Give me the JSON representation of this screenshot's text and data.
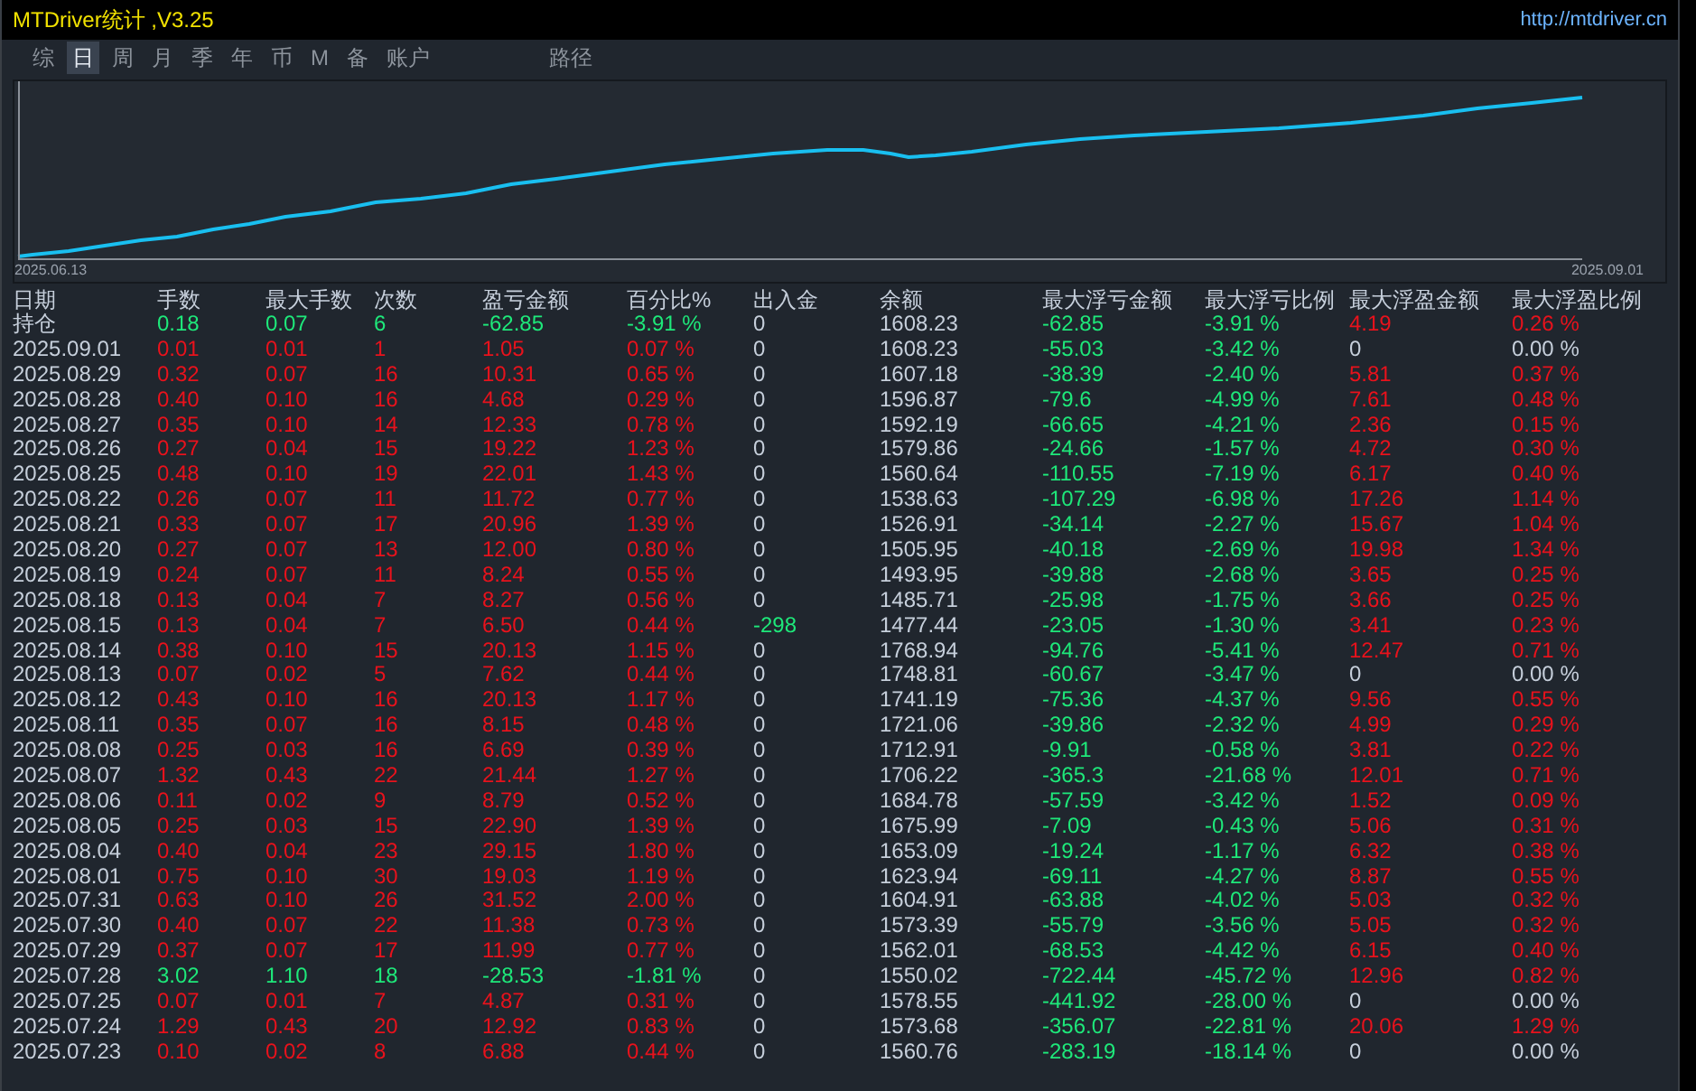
{
  "window": {
    "title": "MTDriver统计 ,V3.25",
    "link": "http://mtdriver.cn"
  },
  "tabs": [
    {
      "label": "综",
      "selected": false
    },
    {
      "label": "日",
      "selected": true
    },
    {
      "label": "周",
      "selected": false
    },
    {
      "label": "月",
      "selected": false
    },
    {
      "label": "季",
      "selected": false
    },
    {
      "label": "年",
      "selected": false
    },
    {
      "label": "币",
      "selected": false
    },
    {
      "label": "M",
      "selected": false
    },
    {
      "label": "备",
      "selected": false
    },
    {
      "label": "账户",
      "selected": false
    },
    {
      "label": "路径",
      "selected": false
    }
  ],
  "chart": {
    "start_label": "2025.06.13",
    "end_label": "2025.09.01"
  },
  "table": {
    "columns": [
      "日期",
      "手数",
      "最大手数",
      "次数",
      "盈亏金额",
      "百分比%",
      "出入金",
      "余额",
      "最大浮亏金额",
      "最大浮亏比例",
      "最大浮盈金额",
      "最大浮盈比例"
    ],
    "rows": [
      {
        "kind": "position",
        "withdrawal": false,
        "float_gain": true,
        "cells": [
          "持仓",
          "0.18",
          "0.07",
          "6",
          "-62.85",
          "-3.91 %",
          "0",
          "1608.23",
          "-62.85",
          "-3.91 %",
          "4.19",
          "0.26 %"
        ]
      },
      {
        "kind": "gain",
        "withdrawal": false,
        "float_gain": false,
        "cells": [
          "2025.09.01",
          "0.01",
          "0.01",
          "1",
          "1.05",
          "0.07 %",
          "0",
          "1608.23",
          "-55.03",
          "-3.42 %",
          "0",
          "0.00 %"
        ]
      },
      {
        "kind": "gain",
        "withdrawal": false,
        "float_gain": true,
        "cells": [
          "2025.08.29",
          "0.32",
          "0.07",
          "16",
          "10.31",
          "0.65 %",
          "0",
          "1607.18",
          "-38.39",
          "-2.40 %",
          "5.81",
          "0.37 %"
        ]
      },
      {
        "kind": "gain",
        "withdrawal": false,
        "float_gain": true,
        "cells": [
          "2025.08.28",
          "0.40",
          "0.10",
          "16",
          "4.68",
          "0.29 %",
          "0",
          "1596.87",
          "-79.6",
          "-4.99 %",
          "7.61",
          "0.48 %"
        ]
      },
      {
        "kind": "gain",
        "withdrawal": false,
        "float_gain": true,
        "cells": [
          "2025.08.27",
          "0.35",
          "0.10",
          "14",
          "12.33",
          "0.78 %",
          "0",
          "1592.19",
          "-66.65",
          "-4.21 %",
          "2.36",
          "0.15 %"
        ]
      },
      {
        "kind": "gain",
        "withdrawal": false,
        "float_gain": true,
        "cells": [
          "2025.08.26",
          "0.27",
          "0.04",
          "15",
          "19.22",
          "1.23 %",
          "0",
          "1579.86",
          "-24.66",
          "-1.57 %",
          "4.72",
          "0.30 %"
        ]
      },
      {
        "kind": "gain",
        "withdrawal": false,
        "float_gain": true,
        "cells": [
          "2025.08.25",
          "0.48",
          "0.10",
          "19",
          "22.01",
          "1.43 %",
          "0",
          "1560.64",
          "-110.55",
          "-7.19 %",
          "6.17",
          "0.40 %"
        ]
      },
      {
        "kind": "gain",
        "withdrawal": false,
        "float_gain": true,
        "cells": [
          "2025.08.22",
          "0.26",
          "0.07",
          "11",
          "11.72",
          "0.77 %",
          "0",
          "1538.63",
          "-107.29",
          "-6.98 %",
          "17.26",
          "1.14 %"
        ]
      },
      {
        "kind": "gain",
        "withdrawal": false,
        "float_gain": true,
        "cells": [
          "2025.08.21",
          "0.33",
          "0.07",
          "17",
          "20.96",
          "1.39 %",
          "0",
          "1526.91",
          "-34.14",
          "-2.27 %",
          "15.67",
          "1.04 %"
        ]
      },
      {
        "kind": "gain",
        "withdrawal": false,
        "float_gain": true,
        "cells": [
          "2025.08.20",
          "0.27",
          "0.07",
          "13",
          "12.00",
          "0.80 %",
          "0",
          "1505.95",
          "-40.18",
          "-2.69 %",
          "19.98",
          "1.34 %"
        ]
      },
      {
        "kind": "gain",
        "withdrawal": false,
        "float_gain": true,
        "cells": [
          "2025.08.19",
          "0.24",
          "0.07",
          "11",
          "8.24",
          "0.55 %",
          "0",
          "1493.95",
          "-39.88",
          "-2.68 %",
          "3.65",
          "0.25 %"
        ]
      },
      {
        "kind": "gain",
        "withdrawal": false,
        "float_gain": true,
        "cells": [
          "2025.08.18",
          "0.13",
          "0.04",
          "7",
          "8.27",
          "0.56 %",
          "0",
          "1485.71",
          "-25.98",
          "-1.75 %",
          "3.66",
          "0.25 %"
        ]
      },
      {
        "kind": "gain",
        "withdrawal": true,
        "float_gain": true,
        "cells": [
          "2025.08.15",
          "0.13",
          "0.04",
          "7",
          "6.50",
          "0.44 %",
          "-298",
          "1477.44",
          "-23.05",
          "-1.30 %",
          "3.41",
          "0.23 %"
        ]
      },
      {
        "kind": "gain",
        "withdrawal": false,
        "float_gain": true,
        "cells": [
          "2025.08.14",
          "0.38",
          "0.10",
          "15",
          "20.13",
          "1.15 %",
          "0",
          "1768.94",
          "-94.76",
          "-5.41 %",
          "12.47",
          "0.71 %"
        ]
      },
      {
        "kind": "gain",
        "withdrawal": false,
        "float_gain": false,
        "cells": [
          "2025.08.13",
          "0.07",
          "0.02",
          "5",
          "7.62",
          "0.44 %",
          "0",
          "1748.81",
          "-60.67",
          "-3.47 %",
          "0",
          "0.00 %"
        ]
      },
      {
        "kind": "gain",
        "withdrawal": false,
        "float_gain": true,
        "cells": [
          "2025.08.12",
          "0.43",
          "0.10",
          "16",
          "20.13",
          "1.17 %",
          "0",
          "1741.19",
          "-75.36",
          "-4.37 %",
          "9.56",
          "0.55 %"
        ]
      },
      {
        "kind": "gain",
        "withdrawal": false,
        "float_gain": true,
        "cells": [
          "2025.08.11",
          "0.35",
          "0.07",
          "16",
          "8.15",
          "0.48 %",
          "0",
          "1721.06",
          "-39.86",
          "-2.32 %",
          "4.99",
          "0.29 %"
        ]
      },
      {
        "kind": "gain",
        "withdrawal": false,
        "float_gain": true,
        "cells": [
          "2025.08.08",
          "0.25",
          "0.03",
          "16",
          "6.69",
          "0.39 %",
          "0",
          "1712.91",
          "-9.91",
          "-0.58 %",
          "3.81",
          "0.22 %"
        ]
      },
      {
        "kind": "gain",
        "withdrawal": false,
        "float_gain": true,
        "cells": [
          "2025.08.07",
          "1.32",
          "0.43",
          "22",
          "21.44",
          "1.27 %",
          "0",
          "1706.22",
          "-365.3",
          "-21.68 %",
          "12.01",
          "0.71 %"
        ]
      },
      {
        "kind": "gain",
        "withdrawal": false,
        "float_gain": true,
        "cells": [
          "2025.08.06",
          "0.11",
          "0.02",
          "9",
          "8.79",
          "0.52 %",
          "0",
          "1684.78",
          "-57.59",
          "-3.42 %",
          "1.52",
          "0.09 %"
        ]
      },
      {
        "kind": "gain",
        "withdrawal": false,
        "float_gain": true,
        "cells": [
          "2025.08.05",
          "0.25",
          "0.03",
          "15",
          "22.90",
          "1.39 %",
          "0",
          "1675.99",
          "-7.09",
          "-0.43 %",
          "5.06",
          "0.31 %"
        ]
      },
      {
        "kind": "gain",
        "withdrawal": false,
        "float_gain": true,
        "cells": [
          "2025.08.04",
          "0.40",
          "0.04",
          "23",
          "29.15",
          "1.80 %",
          "0",
          "1653.09",
          "-19.24",
          "-1.17 %",
          "6.32",
          "0.38 %"
        ]
      },
      {
        "kind": "gain",
        "withdrawal": false,
        "float_gain": true,
        "cells": [
          "2025.08.01",
          "0.75",
          "0.10",
          "30",
          "19.03",
          "1.19 %",
          "0",
          "1623.94",
          "-69.11",
          "-4.27 %",
          "8.87",
          "0.55 %"
        ]
      },
      {
        "kind": "gain",
        "withdrawal": false,
        "float_gain": true,
        "cells": [
          "2025.07.31",
          "0.63",
          "0.10",
          "26",
          "31.52",
          "2.00 %",
          "0",
          "1604.91",
          "-63.88",
          "-4.02 %",
          "5.03",
          "0.32 %"
        ]
      },
      {
        "kind": "gain",
        "withdrawal": false,
        "float_gain": true,
        "cells": [
          "2025.07.30",
          "0.40",
          "0.07",
          "22",
          "11.38",
          "0.73 %",
          "0",
          "1573.39",
          "-55.79",
          "-3.56 %",
          "5.05",
          "0.32 %"
        ]
      },
      {
        "kind": "gain",
        "withdrawal": false,
        "float_gain": true,
        "cells": [
          "2025.07.29",
          "0.37",
          "0.07",
          "17",
          "11.99",
          "0.77 %",
          "0",
          "1562.01",
          "-68.53",
          "-4.42 %",
          "6.15",
          "0.40 %"
        ]
      },
      {
        "kind": "loss",
        "withdrawal": false,
        "float_gain": true,
        "cells": [
          "2025.07.28",
          "3.02",
          "1.10",
          "18",
          "-28.53",
          "-1.81 %",
          "0",
          "1550.02",
          "-722.44",
          "-45.72 %",
          "12.96",
          "0.82 %"
        ]
      },
      {
        "kind": "gain",
        "withdrawal": false,
        "float_gain": false,
        "cells": [
          "2025.07.25",
          "0.07",
          "0.01",
          "7",
          "4.87",
          "0.31 %",
          "0",
          "1578.55",
          "-441.92",
          "-28.00 %",
          "0",
          "0.00 %"
        ]
      },
      {
        "kind": "gain",
        "withdrawal": false,
        "float_gain": true,
        "cells": [
          "2025.07.24",
          "1.29",
          "0.43",
          "20",
          "12.92",
          "0.83 %",
          "0",
          "1573.68",
          "-356.07",
          "-22.81 %",
          "20.06",
          "1.29 %"
        ]
      },
      {
        "kind": "gain",
        "withdrawal": false,
        "float_gain": false,
        "cells": [
          "2025.07.23",
          "0.10",
          "0.02",
          "8",
          "6.88",
          "0.44 %",
          "0",
          "1560.76",
          "-283.19",
          "-18.14 %",
          "0",
          "0.00 %"
        ]
      }
    ]
  }
}
